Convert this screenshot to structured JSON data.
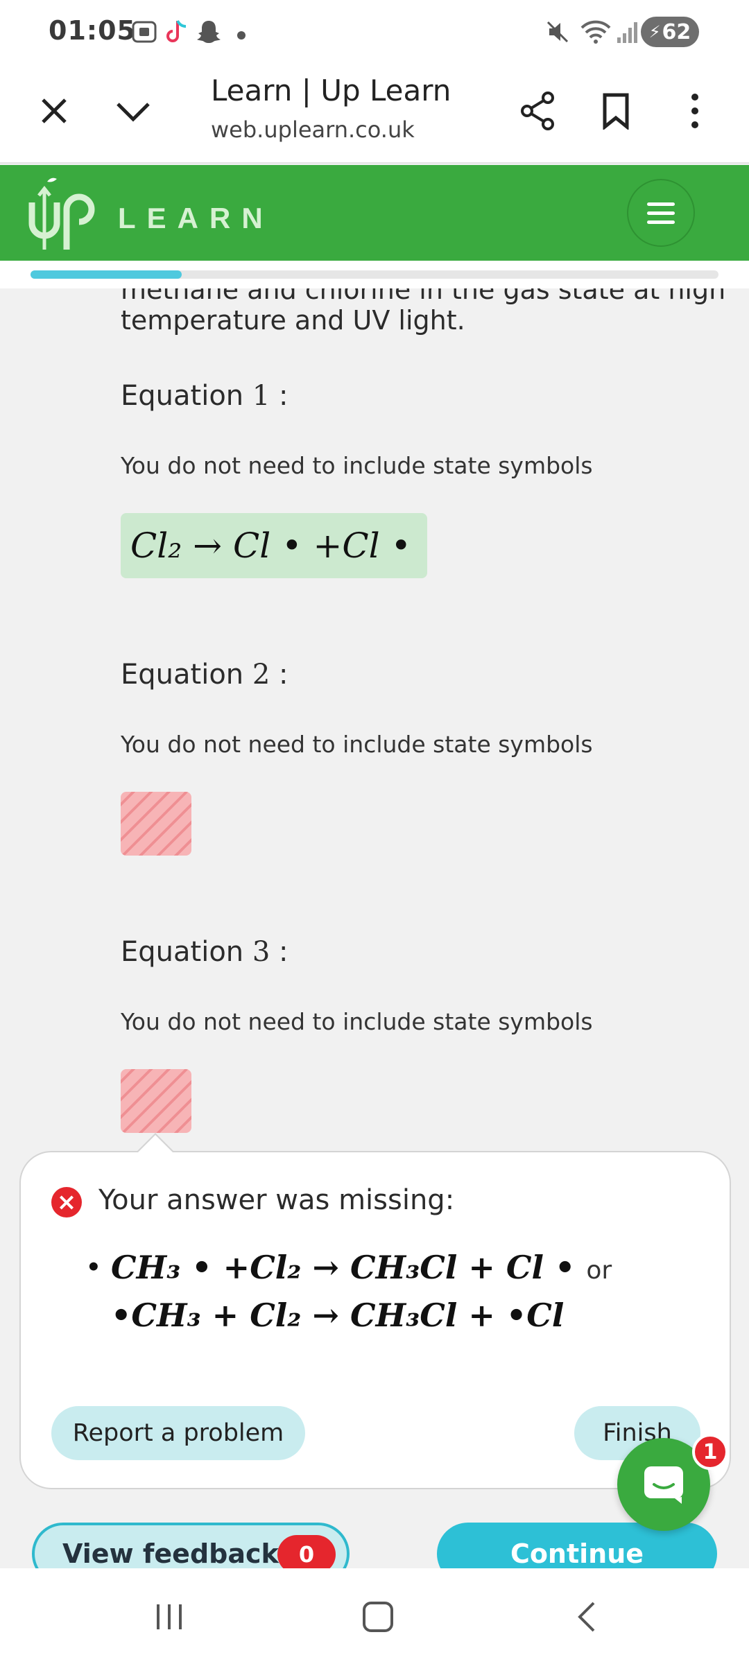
{
  "status_bar": {
    "time": "01:05",
    "battery": "62",
    "icons": [
      "screenshot-icon",
      "tiktok-icon",
      "snapchat-icon",
      "dot-icon",
      "mute-icon",
      "wifi-icon",
      "signal-icon",
      "battery-charging-icon"
    ]
  },
  "browser": {
    "title": "Learn | Up Learn",
    "url": "web.uplearn.co.uk",
    "icons": [
      "close-icon",
      "chevron-down-icon",
      "share-icon",
      "bookmark-icon",
      "more-vert-icon"
    ]
  },
  "header": {
    "logo_mark": "Up",
    "logo_word": "LEARN",
    "accent": "#3aaa3f"
  },
  "progress": {
    "fraction": 0.22,
    "color": "#4fc9de"
  },
  "content": {
    "intro_clipped": "methane and chlorine in the gas state at high",
    "intro": "temperature and UV light.",
    "equations": [
      {
        "label": "Equation",
        "num": "1",
        "colon": ":",
        "hint": "You do not need to include state symbols",
        "answer": "Cl₂ → Cl • +Cl •",
        "status": "correct"
      },
      {
        "label": "Equation",
        "num": "2",
        "colon": ":",
        "hint": "You do not need to include state symbols",
        "answer": "",
        "status": "missing"
      },
      {
        "label": "Equation",
        "num": "3",
        "colon": ":",
        "hint": "You do not need to include state symbols",
        "answer": "",
        "status": "missing"
      }
    ]
  },
  "feedback_popup": {
    "title": "Your answer was missing:",
    "line1": "CH₃ • +Cl₂ → CH₃Cl + Cl •",
    "or": "or",
    "line2": "•CH₃ + Cl₂ → CH₃Cl + •Cl",
    "report_label": "Report a problem",
    "finish_label": "Finish"
  },
  "chat": {
    "badge": "1"
  },
  "actions": {
    "view_feedback_label": "View feedback",
    "feedback_count": "0",
    "continue_label": "Continue"
  },
  "colors": {
    "error": "#e5262d",
    "teal": "#2dc0d6",
    "correct_bg": "#cce9cf"
  }
}
